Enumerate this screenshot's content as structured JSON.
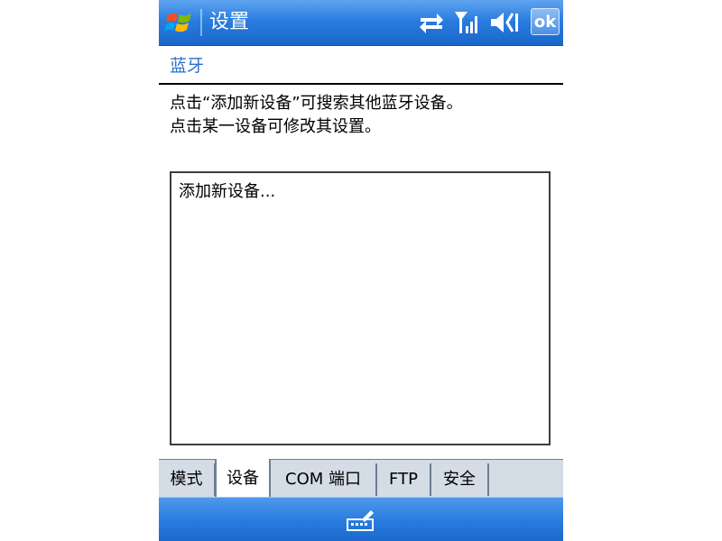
{
  "titlebar": {
    "title": "设置",
    "ok_label": "ok",
    "icons": [
      "windows-start-icon",
      "sync-icon",
      "signal-icon",
      "volume-icon"
    ]
  },
  "heading": "蓝牙",
  "description": {
    "line1": "点击“添加新设备”可搜索其他蓝牙设备。",
    "line2": "点击某一设备可修改其设置。"
  },
  "device_list": {
    "items": [
      "添加新设备..."
    ]
  },
  "tabs": [
    {
      "label": "模式",
      "active": false
    },
    {
      "label": "设备",
      "active": true
    },
    {
      "label": "COM 端口",
      "active": false
    },
    {
      "label": "FTP",
      "active": false
    },
    {
      "label": "安全",
      "active": false
    }
  ],
  "bottombar": {
    "icon": "keyboard-input-icon"
  },
  "colors": {
    "titlebar_blue": "#2a7de0",
    "heading_blue": "#2b71c8",
    "tab_bg": "#d4dce6"
  }
}
